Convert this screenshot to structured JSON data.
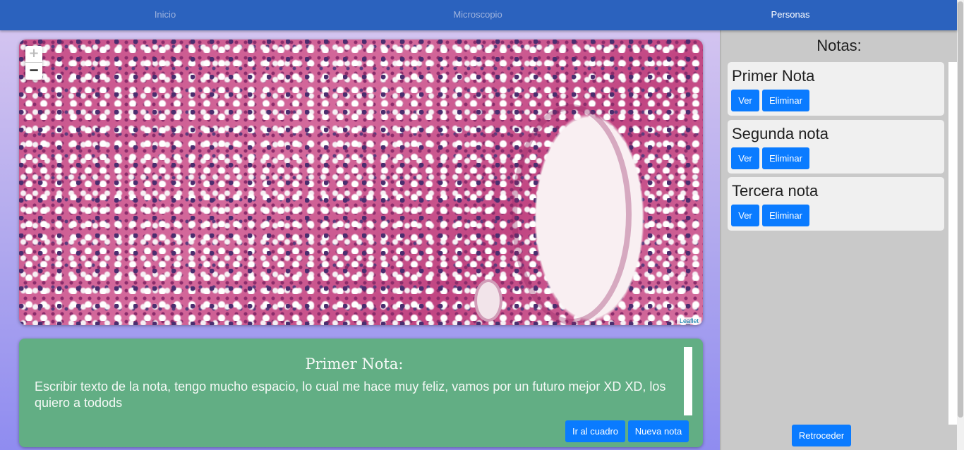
{
  "navbar": {
    "links": [
      {
        "label": "Inicio",
        "active": false
      },
      {
        "label": "Microscopio",
        "active": false
      },
      {
        "label": "Personas",
        "active": true
      }
    ]
  },
  "map": {
    "zoom_in": "+",
    "zoom_out": "−",
    "attribution": "Leaflet"
  },
  "note_view": {
    "title": "Primer Nota:",
    "body": "Escribir texto de la nota, tengo mucho espacio, lo cual me hace muy feliz, vamos por un futuro mejor XD XD, los quiero a todods",
    "goto_label": "Ir al cuadro",
    "new_label": "Nueva nota"
  },
  "sidebar": {
    "title": "Notas:",
    "notes": [
      {
        "title": "Primer Nota",
        "view_label": "Ver",
        "delete_label": "Eliminar"
      },
      {
        "title": "Segunda nota",
        "view_label": "Ver",
        "delete_label": "Eliminar"
      },
      {
        "title": "Tercera nota",
        "view_label": "Ver",
        "delete_label": "Eliminar"
      }
    ],
    "back_label": "Retroceder"
  },
  "colors": {
    "navbar": "#2b62be",
    "button": "#0a7bff",
    "note_panel": "#62ae84",
    "sidebar": "#c9c9c9"
  }
}
